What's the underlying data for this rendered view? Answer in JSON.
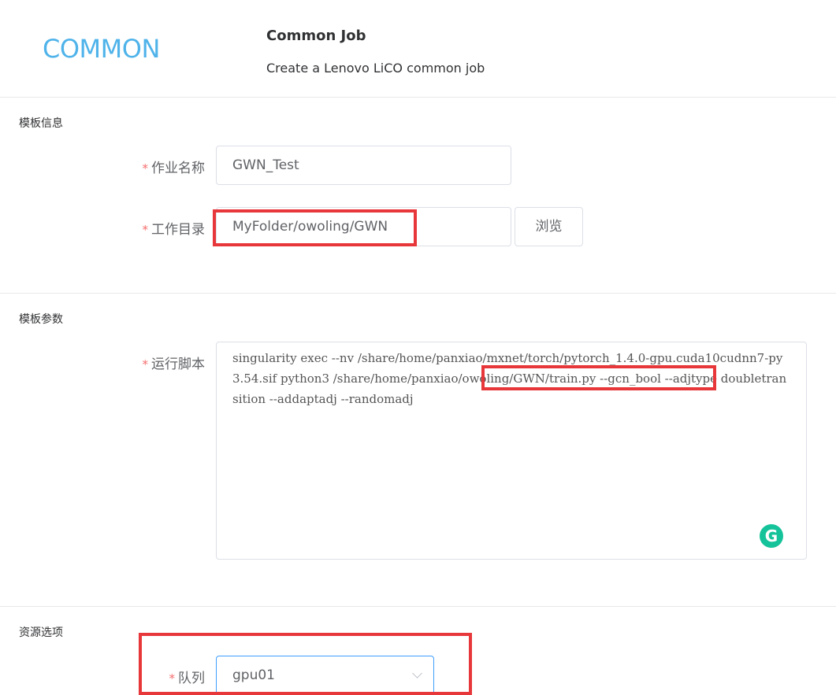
{
  "header": {
    "logo_text": "COMMON",
    "title": "Common Job",
    "description": "Create a Lenovo LiCO common job"
  },
  "template_info": {
    "section_title": "模板信息",
    "job_name": {
      "label": "作业名称",
      "value": "GWN_Test"
    },
    "work_dir": {
      "label": "工作目录",
      "value": "MyFolder/owoling/GWN",
      "browse_label": "浏览"
    }
  },
  "template_params": {
    "section_title": "模板参数",
    "run_script": {
      "label": "运行脚本",
      "value_before": "singularity exec --nv /share/home/panxiao/mxnet/torch/pytorch_1.4.0-gpu.cuda10cudnn7-py3.54.sif python3 ",
      "value_highlight": "/share/home/panxiao/owoling/GWN",
      "value_after": "/train.py --gcn_bool --adjtype doubletransition --addaptadj  --randomadj"
    },
    "grammarly_icon": "G"
  },
  "resource_options": {
    "section_title": "资源选项",
    "queue": {
      "label": "队列",
      "value": "gpu01"
    }
  },
  "required_mark": "*",
  "colors": {
    "logo": "#4fb3ea",
    "required": "#f56c6c",
    "annotation": "#e8373a",
    "grammarly": "#15c39a"
  }
}
